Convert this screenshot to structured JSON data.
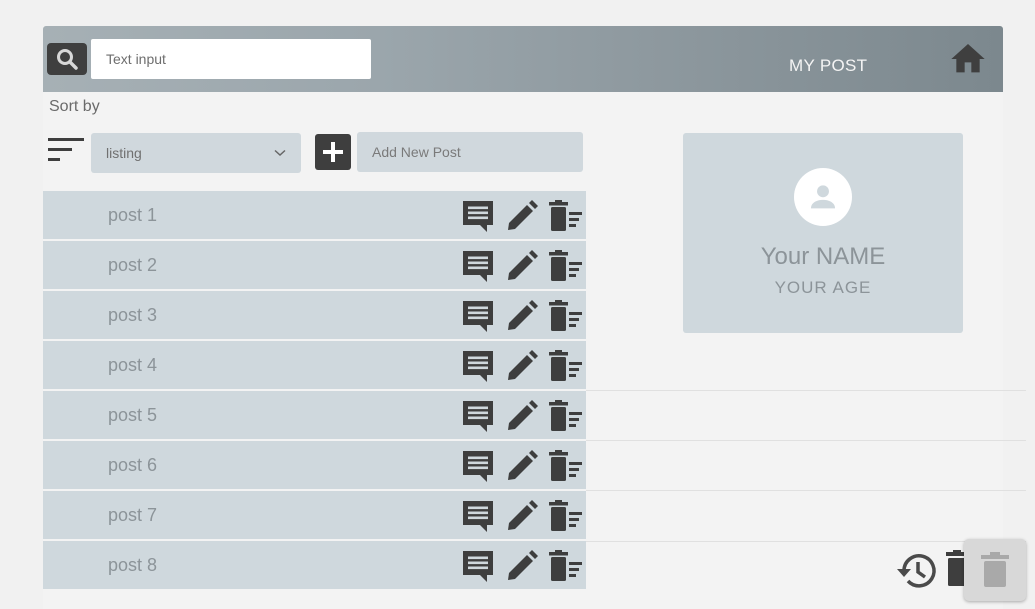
{
  "header": {
    "search_placeholder": "Text input",
    "title": "MY POST"
  },
  "sort": {
    "label": "Sort by",
    "selected": "listing"
  },
  "add_post": {
    "placeholder": "Add New Post"
  },
  "posts": [
    {
      "title": "post 1"
    },
    {
      "title": "post 2"
    },
    {
      "title": "post 3"
    },
    {
      "title": "post 4"
    },
    {
      "title": "post 5"
    },
    {
      "title": "post 6"
    },
    {
      "title": "post 7"
    },
    {
      "title": "post 8"
    }
  ],
  "profile": {
    "name": "Your NAME",
    "age": "YOUR  AGE"
  },
  "icons": {
    "search": "search-icon",
    "home": "home-icon",
    "sort": "sort-icon",
    "add": "plus-icon",
    "comment": "comment-icon",
    "edit": "pencil-icon",
    "delete": "delete-sweep-icon",
    "restore": "restore-icon",
    "trash": "trash-icon"
  },
  "colors": {
    "header_start": "#a6b0b5",
    "header_end": "#7c888e",
    "row_bg": "#cfd8dd",
    "icon_dark": "#3e3e3e"
  }
}
